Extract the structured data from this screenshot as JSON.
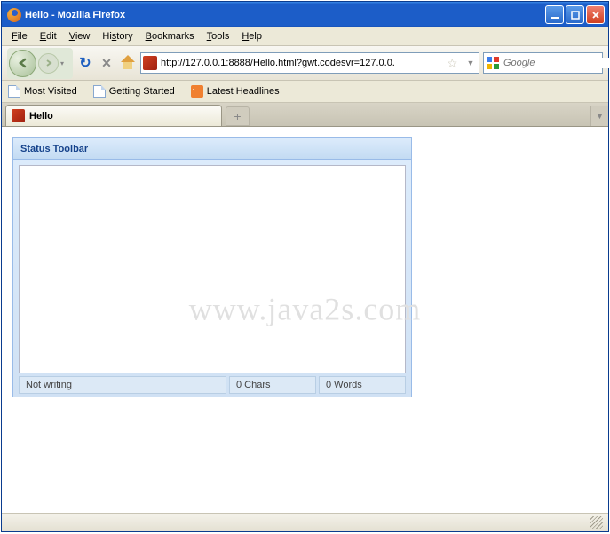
{
  "window": {
    "title": "Hello - Mozilla Firefox"
  },
  "menubar": {
    "file": "File",
    "edit": "Edit",
    "view": "View",
    "history": "History",
    "bookmarks": "Bookmarks",
    "tools": "Tools",
    "help": "Help"
  },
  "navbar": {
    "url": "http://127.0.0.1:8888/Hello.html?gwt.codesvr=127.0.0.",
    "search_placeholder": "Google"
  },
  "bookbar": {
    "most_visited": "Most Visited",
    "getting_started": "Getting Started",
    "latest_headlines": "Latest Headlines"
  },
  "tab": {
    "label": "Hello"
  },
  "panel": {
    "title": "Status Toolbar",
    "status_left": "Not writing",
    "status_chars": "0 Chars",
    "status_words": "0 Words"
  },
  "watermark": "www.java2s.com"
}
